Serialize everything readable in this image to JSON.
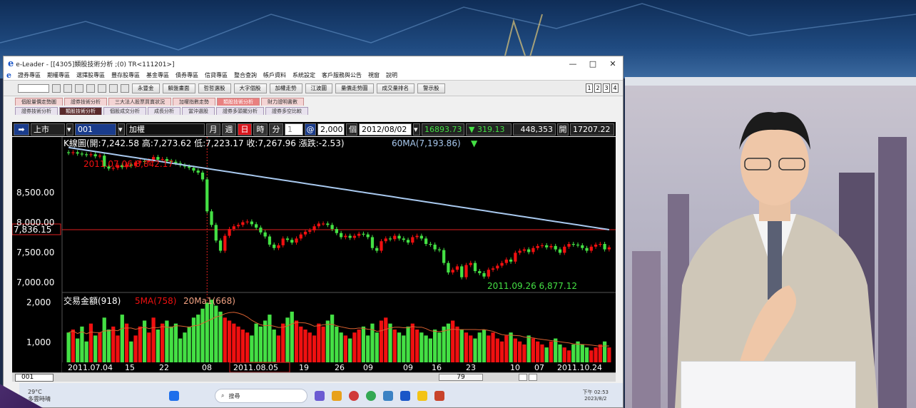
{
  "window": {
    "app_title": "e-Leader - [[4305]類股技術分析 ;(0) TR<111201>]",
    "logo": "e",
    "controls": [
      "—",
      "□",
      "✕"
    ]
  },
  "menu": [
    "證券專區",
    "期權專區",
    "選擇股專區",
    "豐存股專區",
    "基金專區",
    "債券專區",
    "信貸專區",
    "整合查詢",
    "帳戶資料",
    "系統設定",
    "客戶服務與公告",
    "視窗",
    "說明"
  ],
  "toolbar": {
    "buttons": [
      "永豐金",
      "解盤畫面",
      "哲哲選股",
      "大字個股",
      "加權走勢",
      "江波圖",
      "量價走勢圖",
      "成交量排名",
      "警示股"
    ],
    "page_numbers": [
      "1",
      "2",
      "3",
      "4"
    ]
  },
  "tabs_row1": {
    "items": [
      "個股量價走勢圖",
      "證券技術分析",
      "三大法人股票買賣狀況",
      "加權指數走勢",
      "類股技術分析",
      "財力證明書數"
    ],
    "active_index": 4
  },
  "tabs_row2": {
    "items": [
      "證券技術分析",
      "類股技術分析",
      "個股成交分析",
      "成長分析",
      "當沖選股",
      "證券多頭擺分析",
      "證券多空比較"
    ],
    "active_index": 1
  },
  "control_bar": {
    "market": "上市",
    "code": "001",
    "name": "加權",
    "name_prefix_icon": "keyboard-icon",
    "periods": [
      "月",
      "週",
      "日",
      "時",
      "分"
    ],
    "active_period": "日",
    "period_count": "1",
    "at": "@",
    "bar_count": "2,000",
    "bar_unit": "個",
    "date": "2012/08/02",
    "price": "16893.73",
    "change_arrow": "▼",
    "change": "319.13",
    "volume": "448,353",
    "open_label": "開",
    "open_value": "17207.22"
  },
  "chart_data": {
    "type": "candlestick",
    "kline_info": "K線圖(開:7,242.58 高:7,273.62 低:7,223.17 收:7,267.96 漲跌:-2.53)",
    "ma60_label": "60MA(7,193.86)",
    "ma60_arrow": "▼",
    "high_annotation": "2011.07.06  8,842.17",
    "low_annotation": "2011.09.26  6,877.12",
    "crosshair_value": "7,836.15",
    "price_ticks": [
      "8,500.00",
      "8,000.00",
      "7,500.00",
      "7,000.00"
    ],
    "price_tick_values": [
      8500,
      8000,
      7500,
      7000
    ],
    "price_range": [
      6850,
      8950
    ],
    "volume_info": "交易金額(918)",
    "sma5_label": "5MA(758)",
    "sma20_label": "20Ma1(668)",
    "volume_ticks": [
      "2,000",
      "1,000"
    ],
    "volume_tick_values": [
      2000,
      1000
    ],
    "volume_range": [
      0,
      2200
    ],
    "date_labels": [
      "2011.07.04",
      "15",
      "22",
      "08",
      "2011.08.05",
      "19",
      "26",
      "09",
      "09",
      "16",
      "23",
      "10",
      "07",
      "2011.10.24"
    ],
    "closes": [
      8820,
      8830,
      8810,
      8800,
      8790,
      8800,
      8770,
      8780,
      8620,
      8590,
      8600,
      8640,
      8610,
      8650,
      8630,
      8680,
      8700,
      8690,
      8710,
      8760,
      8720,
      8730,
      8700,
      8690,
      8670,
      8640,
      8620,
      8600,
      8560,
      8530,
      8430,
      7960,
      7760,
      7530,
      7380,
      7600,
      7700,
      7740,
      7760,
      7800,
      7810,
      7770,
      7720,
      7650,
      7590,
      7470,
      7420,
      7460,
      7560,
      7540,
      7500,
      7560,
      7620,
      7660,
      7680,
      7740,
      7780,
      7780,
      7760,
      7700,
      7640,
      7580,
      7600,
      7570,
      7600,
      7630,
      7620,
      7580,
      7420,
      7380,
      7520,
      7560,
      7550,
      7600,
      7560,
      7540,
      7500,
      7580,
      7600,
      7560,
      7480,
      7470,
      7400,
      7390,
      7200,
      7060,
      7100,
      7150,
      6990,
      7170,
      7200,
      7080,
      7050,
      7000,
      7100,
      7120,
      7160,
      7200,
      7250,
      7220,
      7350,
      7380,
      7400,
      7360,
      7420,
      7450,
      7460,
      7430,
      7450,
      7400,
      7350,
      7440,
      7480,
      7470,
      7460,
      7420,
      7380,
      7440,
      7470,
      7480,
      7400,
      7430
    ],
    "volumes": [
      1000,
      1100,
      800,
      1200,
      700,
      1300,
      900,
      1000,
      1500,
      1100,
      1200,
      900,
      1600,
      1300,
      700,
      900,
      1200,
      1400,
      1000,
      1500,
      1100,
      1300,
      1400,
      1200,
      1300,
      800,
      1000,
      1200,
      1500,
      1600,
      1800,
      2000,
      2100,
      1900,
      1700,
      1500,
      1400,
      1300,
      1200,
      1100,
      1000,
      900,
      1300,
      1200,
      1400,
      1600,
      1100,
      900,
      1300,
      1500,
      1700,
      1400,
      1200,
      1100,
      1000,
      900,
      1300,
      1200,
      1400,
      1600,
      1200,
      1000,
      900,
      800,
      1000,
      1100,
      1200,
      900,
      1300,
      1000,
      1400,
      1500,
      1300,
      1100,
      1000,
      900,
      1200,
      1300,
      1100,
      1000,
      900,
      800,
      1100,
      1000,
      1200,
      1300,
      1400,
      1200,
      1100,
      1000,
      900,
      800,
      1000,
      1100,
      900,
      1000,
      800,
      700,
      900,
      1000,
      800,
      700,
      600,
      900,
      800,
      700,
      600,
      500,
      700,
      800,
      600,
      500,
      400,
      600,
      700,
      600,
      500,
      400,
      500,
      600,
      700,
      500
    ],
    "ma60": [
      8900,
      8890,
      8880,
      8870,
      8860,
      8850,
      8840,
      8830,
      8820,
      8810,
      8800,
      8790,
      8780,
      8770,
      8760,
      8750,
      8740,
      8730,
      8720,
      8710,
      8700,
      8690,
      8680,
      8670,
      8660,
      8650,
      8640,
      8630,
      8620,
      8610,
      8600,
      8590,
      8580,
      8570,
      8560,
      8550,
      8540,
      8530,
      8520,
      8510,
      8500,
      8490,
      8480,
      8470,
      8460,
      8450,
      8440,
      8430,
      8420,
      8410,
      8400,
      8390,
      8380,
      8370,
      8360,
      8350,
      8340,
      8330,
      8320,
      8310,
      8300,
      8290,
      8280,
      8270,
      8260,
      8250,
      8240,
      8230,
      8220,
      8210,
      8200,
      8190,
      8180,
      8170,
      8160,
      8150,
      8140,
      8130,
      8120,
      8110,
      8100,
      8090,
      8080,
      8070,
      8060,
      8050,
      8040,
      8030,
      8020,
      8010,
      8000,
      7990,
      7980,
      7970,
      7960,
      7950,
      7940,
      7930,
      7920,
      7910,
      7900,
      7890,
      7880,
      7870,
      7860,
      7850,
      7840,
      7830,
      7820,
      7810,
      7800,
      7790,
      7780,
      7770,
      7760,
      7750,
      7740,
      7730,
      7720,
      7710,
      7700,
      7690
    ],
    "grid": false,
    "crosshair_index": 31,
    "bottom_counter": "001",
    "scroll_value": "79"
  },
  "taskbar": {
    "temperature": "29°C",
    "weather": "多雲時晴",
    "search_placeholder": "搜尋",
    "time": "下午 02:53",
    "date": "2023/8/2"
  },
  "colors": {
    "up": "#f01010",
    "down": "#44e044",
    "ma": "#a8c8ee",
    "crosshair": "#e02020"
  }
}
